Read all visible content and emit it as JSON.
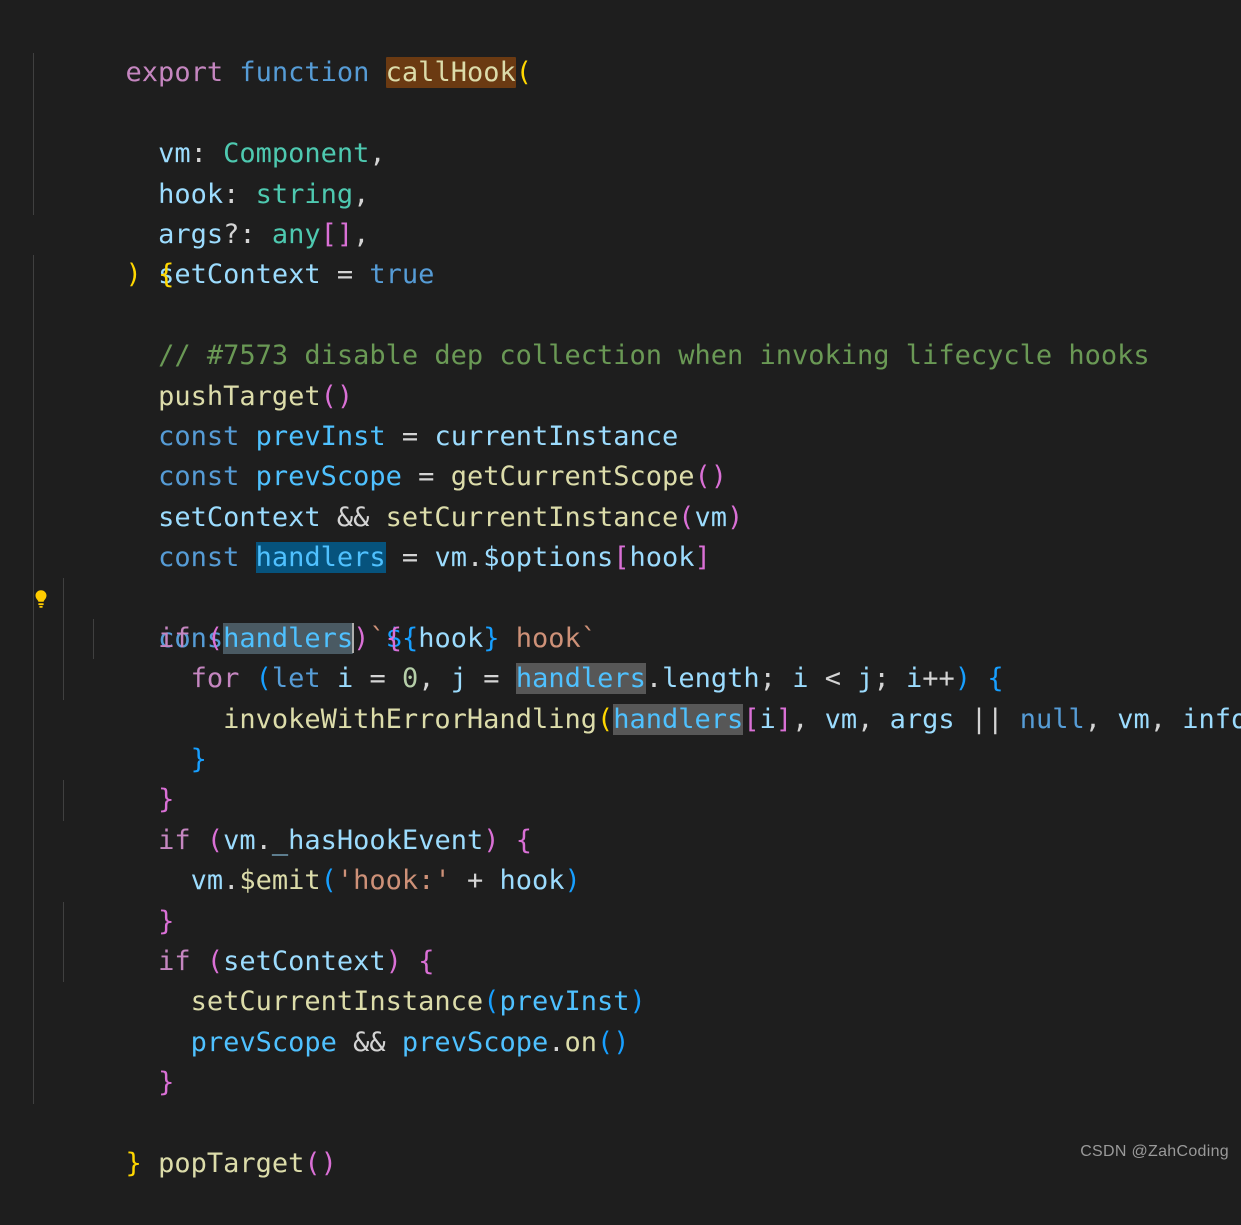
{
  "editor": {
    "background_color": "#1e1e1e",
    "language": "typescript",
    "find_match_text": "callHook",
    "find_match_color": "#6b3a12",
    "selection_color": "#06537d",
    "word_highlight_color": "#575757",
    "cursor_word_highlight_color": "#4a5a63",
    "highlighted_symbol": "handlers",
    "code_action_icon": "lightbulb-icon",
    "code_action_icon_color": "#ffcc00"
  },
  "code": {
    "lines": [
      "export function callHook(",
      "  vm: Component,",
      "  hook: string,",
      "  args?: any[],",
      "  setContext = true",
      ") {",
      "  // #7573 disable dep collection when invoking lifecycle hooks",
      "  pushTarget()",
      "  const prevInst = currentInstance",
      "  const prevScope = getCurrentScope()",
      "  setContext && setCurrentInstance(vm)",
      "  const handlers = vm.$options[hook]",
      "  const info = `${hook} hook`",
      "  if (handlers) {",
      "    for (let i = 0, j = handlers.length; i < j; i++) {",
      "      invokeWithErrorHandling(handlers[i], vm, args || null, vm, info)",
      "    }",
      "  }",
      "  if (vm._hasHookEvent) {",
      "    vm.$emit('hook:' + hook)",
      "  }",
      "  if (setContext) {",
      "    setCurrentInstance(prevInst)",
      "    prevScope && prevScope.on()",
      "  }",
      "",
      "  popTarget()",
      "}"
    ],
    "comment_text": "// #7573 disable dep collection when invoking lifecycle hooks",
    "function_name": "callHook",
    "parameters": [
      {
        "name": "vm",
        "type": "Component"
      },
      {
        "name": "hook",
        "type": "string"
      },
      {
        "name": "args",
        "optional": true,
        "type": "any[]"
      },
      {
        "name": "setContext",
        "default": "true"
      }
    ]
  },
  "watermark": {
    "text": "CSDN @ZahCoding"
  },
  "syntax_colors": {
    "keyword_control": "#c586c0",
    "keyword_declaration": "#569cd6",
    "function": "#dcdcaa",
    "variable": "#9cdcfe",
    "variable_const": "#4fc1ff",
    "type": "#4ec9b0",
    "string": "#ce9178",
    "comment": "#6a9955",
    "number": "#b5cea8",
    "operator": "#d4d4d4",
    "bracket_level1": "#ffd700",
    "bracket_level2": "#da70d6",
    "bracket_level3": "#179fff"
  }
}
